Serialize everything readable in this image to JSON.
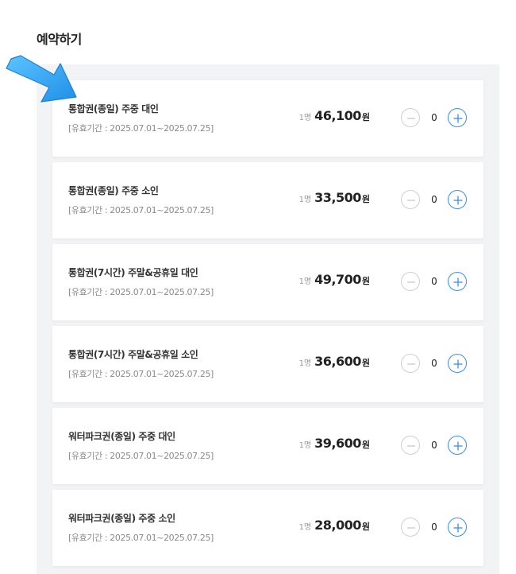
{
  "section": {
    "title": "예약하기"
  },
  "tickets": [
    {
      "name": "통합권(종일) 주중 대인",
      "period": "[유효기간 : 2025.07.01~2025.07.25]",
      "per": "1명",
      "price": "46,100",
      "unit": "원",
      "qty": "0"
    },
    {
      "name": "통합권(종일) 주중 소인",
      "period": "[유효기간 : 2025.07.01~2025.07.25]",
      "per": "1명",
      "price": "33,500",
      "unit": "원",
      "qty": "0"
    },
    {
      "name": "통합권(7시간) 주말&공휴일 대인",
      "period": "[유효기간 : 2025.07.01~2025.07.25]",
      "per": "1명",
      "price": "49,700",
      "unit": "원",
      "qty": "0"
    },
    {
      "name": "통합권(7시간) 주말&공휴일 소인",
      "period": "[유효기간 : 2025.07.01~2025.07.25]",
      "per": "1명",
      "price": "36,600",
      "unit": "원",
      "qty": "0"
    },
    {
      "name": "워터파크권(종일) 주중 대인",
      "period": "[유효기간 : 2025.07.01~2025.07.25]",
      "per": "1명",
      "price": "39,600",
      "unit": "원",
      "qty": "0"
    },
    {
      "name": "워터파크권(종일) 주중 소인",
      "period": "[유효기간 : 2025.07.01~2025.07.25]",
      "per": "1명",
      "price": "28,000",
      "unit": "원",
      "qty": "0"
    }
  ],
  "icons": {
    "pointer": "arrow-pointer-icon",
    "minus": "minus-icon",
    "plus": "plus-icon"
  },
  "colors": {
    "accent": "#3a8ee6",
    "arrow": "#33a9f5",
    "panel": "#f2f3f5"
  }
}
